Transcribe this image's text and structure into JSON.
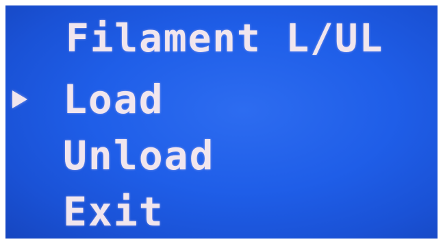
{
  "menu": {
    "title": "Filament L/UL",
    "items": [
      {
        "label": "Load",
        "selected": true
      },
      {
        "label": "Unload",
        "selected": false
      },
      {
        "label": "Exit",
        "selected": false
      }
    ],
    "cursor_icon": "triangle-right-icon"
  },
  "colors": {
    "background": "#1f5ee8",
    "text": "#f1e6ee",
    "bezel": "#ffffff"
  }
}
